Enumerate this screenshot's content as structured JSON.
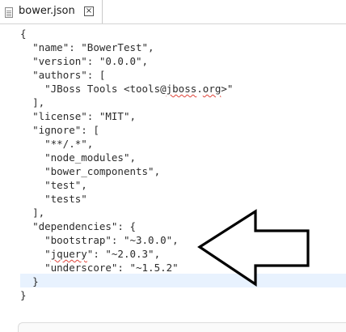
{
  "editor_tab": {
    "title": "bower.json",
    "file_icon": "file-icon",
    "close_icon": "close-icon",
    "close_glyph": "×"
  },
  "code_lines": [
    {
      "indent": "",
      "text": "{"
    },
    {
      "indent": "  ",
      "text": "\"name\": \"BowerTest\","
    },
    {
      "indent": "  ",
      "text": "\"version\": \"0.0.0\","
    },
    {
      "indent": "  ",
      "text": "\"authors\": ["
    },
    {
      "indent": "    ",
      "pre": "\"JBoss Tools <tools@",
      "spell": "jboss",
      "post": ".",
      "spell2": "org",
      "post2": ">\""
    },
    {
      "indent": "  ",
      "text": "],"
    },
    {
      "indent": "  ",
      "text": "\"license\": \"MIT\","
    },
    {
      "indent": "  ",
      "text": "\"ignore\": ["
    },
    {
      "indent": "    ",
      "text": "\"**/.*\","
    },
    {
      "indent": "    ",
      "text": "\"node_modules\","
    },
    {
      "indent": "    ",
      "text": "\"bower_components\","
    },
    {
      "indent": "    ",
      "text": "\"test\","
    },
    {
      "indent": "    ",
      "text": "\"tests\""
    },
    {
      "indent": "  ",
      "text": "],"
    },
    {
      "indent": "  ",
      "text": "\"dependencies\": {"
    },
    {
      "indent": "    ",
      "text": "\"bootstrap\": \"~3.0.0\","
    },
    {
      "indent": "    ",
      "pre": "\"",
      "spell": "jquery",
      "post": "\": \"~2.0.3\","
    },
    {
      "indent": "    ",
      "text": "\"underscore\": \"~1.5.2\""
    },
    {
      "indent": "  ",
      "text": "}"
    },
    {
      "indent": "",
      "text": "}"
    }
  ],
  "annotation": {
    "arrow_icon": "left-arrow-icon",
    "stroke_color": "#000000",
    "fill_color": "#ffffff"
  },
  "colors": {
    "current_line": "#e8f2fe",
    "spelling_underline": "#e0443a"
  }
}
